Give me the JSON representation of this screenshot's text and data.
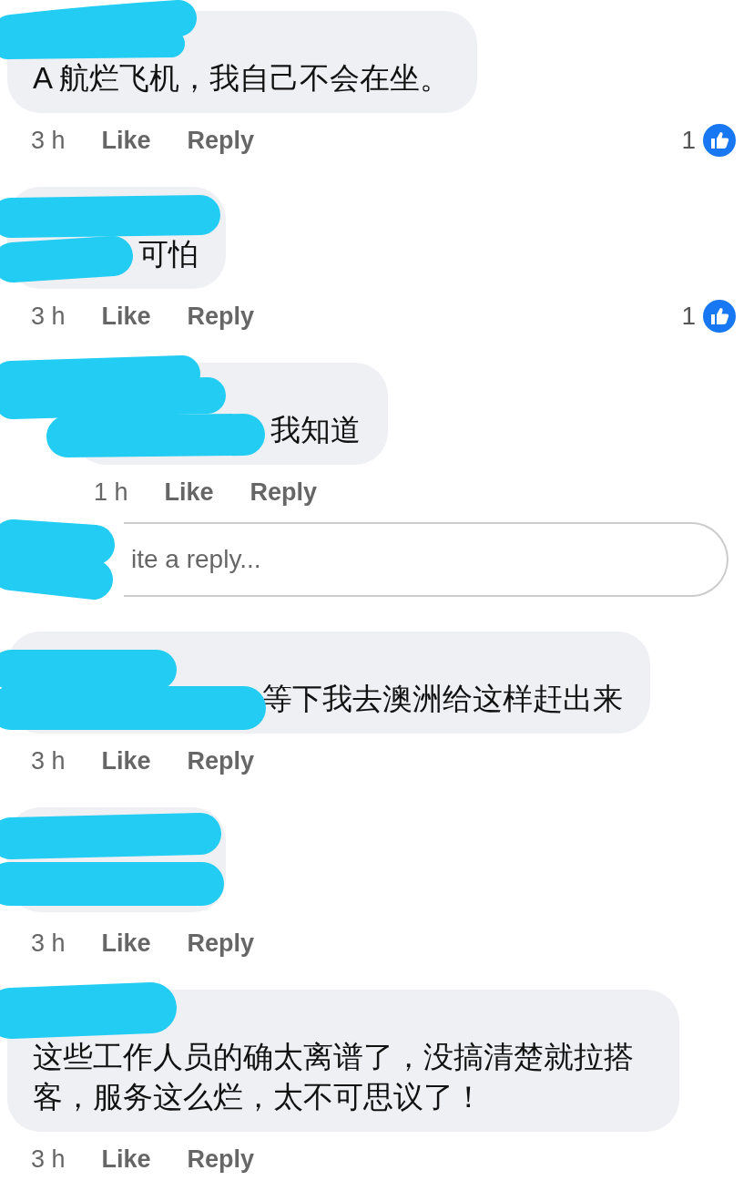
{
  "comments": [
    {
      "text": "A 航烂飞机，我自己不会在坐。",
      "time": "3 h",
      "like": "Like",
      "reply": "Reply",
      "reactions": "1",
      "name_redacted": true
    },
    {
      "text": "可怕",
      "time": "3 h",
      "like": "Like",
      "reply": "Reply",
      "reactions": "1",
      "name_redacted": true,
      "children": [
        {
          "text": "我知道",
          "time": "1 h",
          "like": "Like",
          "reply": "Reply",
          "name_redacted": true
        }
      ],
      "reply_field": {
        "placeholder": "ite a reply...",
        "name_redacted": true
      }
    },
    {
      "text": "等下我去澳洲给这样赶出来",
      "time": "3 h",
      "like": "Like",
      "reply": "Reply",
      "name_redacted": true
    },
    {
      "time": "3 h",
      "like": "Like",
      "reply": "Reply",
      "name_redacted": true
    },
    {
      "text": "这些工作人员的确太离谱了，没搞清楚就拉搭客，服务这么烂，太不可思议了！",
      "time": "3 h",
      "like": "Like",
      "reply": "Reply",
      "name_redacted": true
    }
  ]
}
